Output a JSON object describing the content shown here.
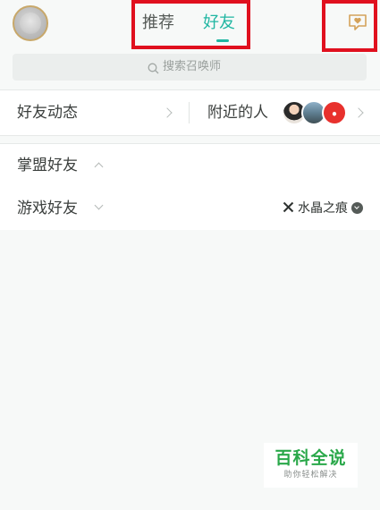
{
  "header": {
    "tabs": [
      {
        "label": "推荐",
        "active": false
      },
      {
        "label": "好友",
        "active": true
      }
    ],
    "accent_color": "#20b6a2",
    "highlight_color": "#e0101e",
    "avatar_icon": "profile-avatar",
    "message_icon": "heart-message-icon"
  },
  "search": {
    "placeholder": "搜索召唤师",
    "icon": "search-icon"
  },
  "friends_row": {
    "dynamics_label": "好友动态",
    "nearby_label": "附近的人"
  },
  "groups": [
    {
      "label": "掌盟好友",
      "expanded": true
    },
    {
      "label": "游戏好友",
      "expanded": false,
      "region": "水晶之痕"
    }
  ],
  "watermark": {
    "title": "百科全说",
    "subtitle": "助你轻松解决"
  }
}
